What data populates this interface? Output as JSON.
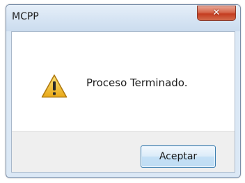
{
  "window": {
    "title": "MCPP",
    "close_icon": "close-icon"
  },
  "dialog": {
    "icon": "warning-icon",
    "message": "Proceso Terminado.",
    "ok_label": "Aceptar"
  },
  "colors": {
    "close_button": "#c94a2c",
    "warning_fill": "#f3c331",
    "button_border": "#3c7fb1"
  }
}
